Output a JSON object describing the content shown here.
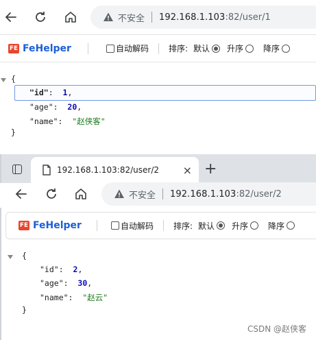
{
  "window1": {
    "nav": {
      "back_icon": "arrow-left-icon",
      "reload_icon": "reload-icon",
      "home_icon": "home-icon"
    },
    "address": {
      "security_label": "不安全",
      "url_host": "192.168.1.103",
      "url_rest": ":82/user/1"
    },
    "fehelper": {
      "name": "FeHelper",
      "auto_decode_label": "自动解码",
      "sort_label": "排序:",
      "sort_default": "默认",
      "sort_asc": "升序",
      "sort_desc": "降序"
    },
    "json": {
      "open": "{",
      "close": "}",
      "lines": [
        {
          "key": "\"id\"",
          "colon": ":",
          "value": "1",
          "comma": ","
        },
        {
          "key": "\"age\"",
          "colon": ":",
          "value": "20",
          "comma": ","
        },
        {
          "key": "\"name\"",
          "colon": ":",
          "value": "\"赵侠客\"",
          "comma": ""
        }
      ]
    }
  },
  "window2": {
    "tab": {
      "title": "192.168.1.103:82/user/2",
      "close": "×",
      "new_tab": "+"
    },
    "address": {
      "security_label": "不安全",
      "url_host": "192.168.1.103",
      "url_rest": ":82/user/2"
    },
    "fehelper": {
      "name": "FeHelper",
      "auto_decode_label": "自动解码",
      "sort_label": "排序:",
      "sort_default": "默认",
      "sort_asc": "升序",
      "sort_desc": "降序"
    },
    "json": {
      "open": "{",
      "close": "}",
      "lines": [
        {
          "key": "\"id\"",
          "colon": ":",
          "value": "2",
          "comma": ","
        },
        {
          "key": "\"age\"",
          "colon": ":",
          "value": "30",
          "comma": ","
        },
        {
          "key": "\"name\"",
          "colon": ":",
          "value": "\"赵云\"",
          "comma": ""
        }
      ]
    }
  },
  "watermark": "CSDN @赵侠客",
  "colors": {
    "fehelper_blue": "#1c5ed6",
    "fehelper_red": "#e8452c",
    "number": "#0b0bb5",
    "string": "#1a7a1a"
  }
}
